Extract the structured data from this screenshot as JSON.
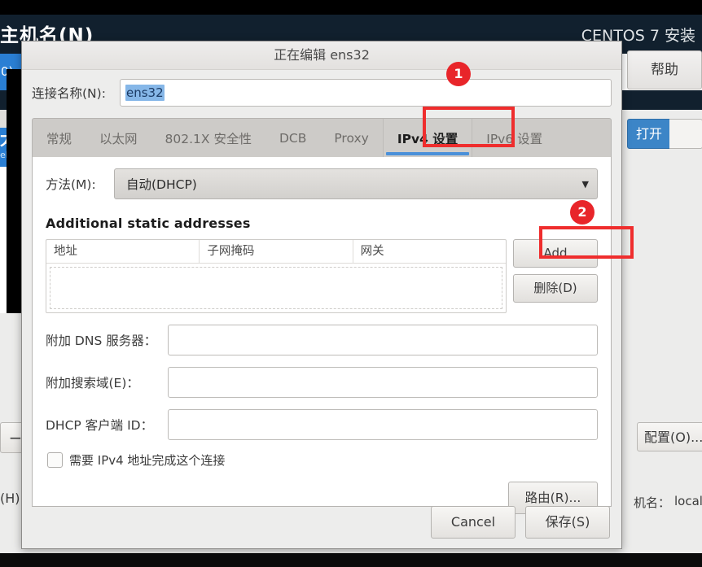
{
  "background": {
    "window_title": "主机名(N)",
    "product_title": "CENTOS 7 安装",
    "help_button": "帮助",
    "list_item_1": "0)",
    "list_item_2": "太",
    "list_item_2_sub": "el",
    "open_button": "打开",
    "minus_button": "−",
    "help_label": "(H)",
    "config_button": "配置(O)...",
    "hostname_label": "机名：",
    "hostname_value": "local"
  },
  "dialog": {
    "title": "正在编辑 ens32",
    "connection_name": {
      "label": "连接名称(N):",
      "value": "ens32"
    },
    "tabs": [
      {
        "label": "常规",
        "active": false
      },
      {
        "label": "以太网",
        "active": false
      },
      {
        "label": "802.1X 安全性",
        "active": false
      },
      {
        "label": "DCB",
        "active": false
      },
      {
        "label": "Proxy",
        "active": false
      },
      {
        "label": "IPv4 设置",
        "active": true
      },
      {
        "label": "IPv6 设置",
        "active": false
      }
    ],
    "method": {
      "label": "方法(M):",
      "value": "自动(DHCP)",
      "arrow": "chevron-down-icon"
    },
    "static_addresses": {
      "section_title": "Additional static addresses",
      "columns": [
        "地址",
        "子网掩码",
        "网关"
      ],
      "rows": [],
      "add_button": "Add",
      "delete_button": "删除(D)"
    },
    "fields": [
      {
        "label": "附加 DNS 服务器：",
        "value": ""
      },
      {
        "label": "附加搜索域(E)：",
        "value": ""
      },
      {
        "label": "DHCP 客户端 ID：",
        "value": ""
      }
    ],
    "require_ipv4": {
      "label": "需要 IPv4 地址完成这个连接",
      "checked": false
    },
    "routes_button": "路由(R)...",
    "footer": {
      "cancel": "Cancel",
      "save": "保存(S)"
    }
  },
  "annotations": {
    "badge_1": "1",
    "badge_2": "2",
    "highlight_color": "#ef2d2d"
  }
}
